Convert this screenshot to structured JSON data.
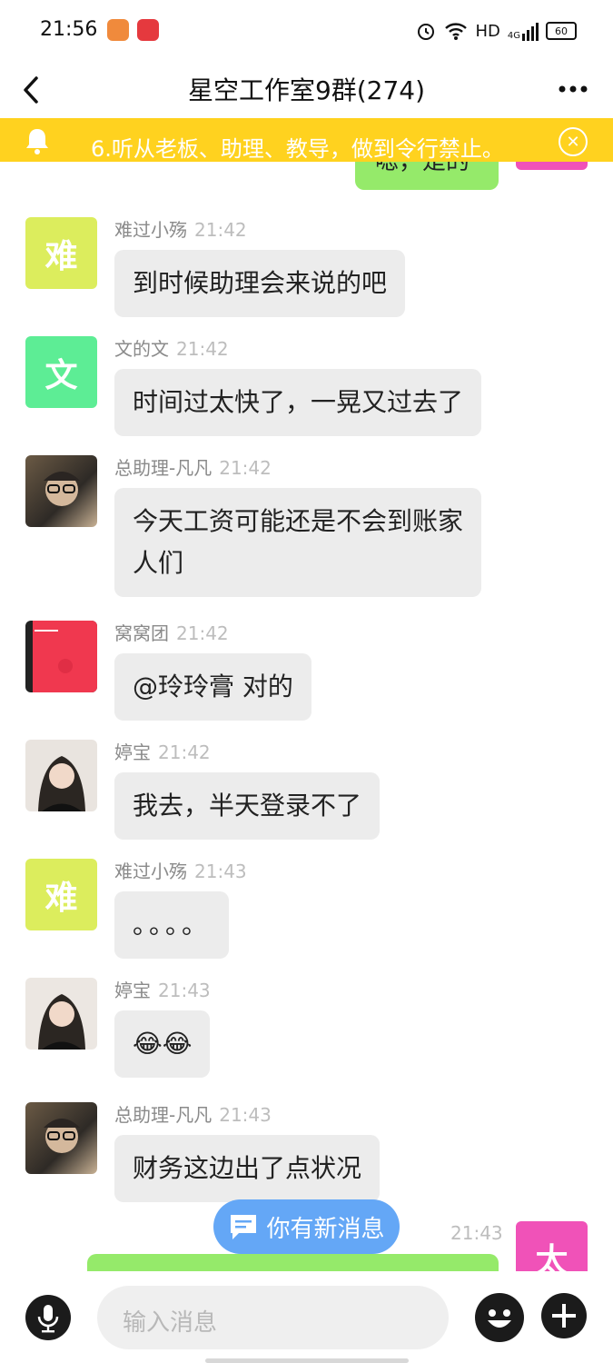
{
  "status_bar": {
    "time": "21:56",
    "network": "HD",
    "signal_label": "4G",
    "battery": "60"
  },
  "header": {
    "title": "星空工作室9群(274)"
  },
  "notice": {
    "text": "6.听从老板、助理、教导，做到令行禁止。"
  },
  "partial_top_bubble": "嗯，是的",
  "messages": [
    {
      "name": "难过小殇",
      "time": "21:42",
      "text": "到时候助理会来说的吧",
      "avatar_text": "难",
      "avatar_color": "#dced5d"
    },
    {
      "name": "文的文",
      "time": "21:42",
      "text": "时间过太快了，一晃又过去了",
      "avatar_text": "文",
      "avatar_color": "#5ded95"
    },
    {
      "name": "总助理-凡凡",
      "time": "21:42",
      "text_line1": "今天工资可能还是不会到账家",
      "text_line2": "人们",
      "avatar_text": ""
    },
    {
      "name": "窝窝团",
      "time": "21:42",
      "text": "@玲玲膏 对的",
      "avatar_text": ""
    },
    {
      "name": "婷宝",
      "time": "21:42",
      "text": "我去，半天登录不了",
      "avatar_text": ""
    },
    {
      "name": "难过小殇",
      "time": "21:43",
      "text": "。。。。",
      "avatar_text": "难",
      "avatar_color": "#dced5d"
    },
    {
      "name": "婷宝",
      "time": "21:43",
      "text": "😂😂",
      "avatar_text": ""
    },
    {
      "name": "总助理-凡凡",
      "time": "21:43",
      "text": "财务这边出了点状况",
      "avatar_text": ""
    }
  ],
  "own_message": {
    "time": "21:43",
    "avatar_text": "太",
    "avatar_color": "#f052b8"
  },
  "new_message_toast": "你有新消息",
  "input": {
    "placeholder": "输入消息"
  },
  "colors": {
    "notice_bg": "#ffd21f",
    "own_bubble": "#95ea6a",
    "toast_bg": "#64a7f6"
  }
}
